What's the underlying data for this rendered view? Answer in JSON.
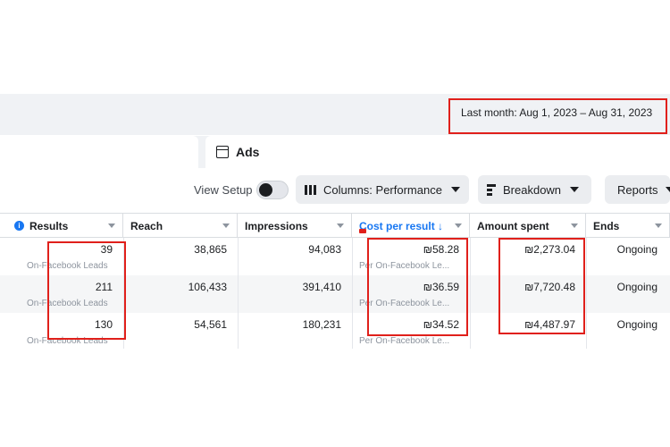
{
  "date_range": "Last month: Aug 1, 2023 – Aug 31, 2023",
  "tabs": {
    "ads": "Ads"
  },
  "toolbar": {
    "view_setup": "View Setup",
    "columns": "Columns: Performance",
    "breakdown": "Breakdown",
    "reports": "Reports"
  },
  "table": {
    "headers": {
      "results": "Results",
      "reach": "Reach",
      "impressions": "Impressions",
      "cost_per_result": "Cost per result ↓",
      "amount_spent": "Amount spent",
      "ends": "Ends"
    },
    "rows": [
      {
        "results": "39",
        "results_sub": "On-Facebook Leads",
        "reach": "38,865",
        "impressions": "94,083",
        "cost": "₪58.28",
        "cost_sub": "Per On-Facebook Le...",
        "spent": "₪2,273.04",
        "ends": "Ongoing"
      },
      {
        "results": "211",
        "results_sub": "On-Facebook Leads",
        "reach": "106,433",
        "impressions": "391,410",
        "cost": "₪36.59",
        "cost_sub": "Per On-Facebook Le...",
        "spent": "₪7,720.48",
        "ends": "Ongoing"
      },
      {
        "results": "130",
        "results_sub": "On-Facebook Leads",
        "reach": "54,561",
        "impressions": "180,231",
        "cost": "₪34.52",
        "cost_sub": "Per On-Facebook Le...",
        "spent": "₪4,487.97",
        "ends": "Ongoing"
      }
    ]
  },
  "colors": {
    "accent": "#1877f2",
    "highlight_box": "#e0201b"
  }
}
